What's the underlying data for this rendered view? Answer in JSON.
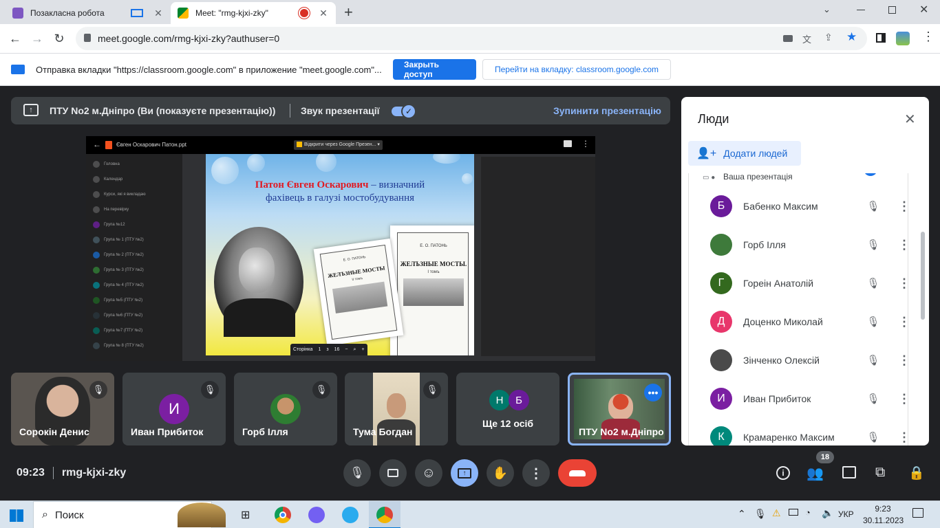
{
  "browser": {
    "tabs": [
      {
        "title": "Позакласна робота",
        "active": false
      },
      {
        "title": "Meet: \"rmg-kjxi-zky\"",
        "active": true
      }
    ],
    "new_tab": "+",
    "url": "meet.google.com/rmg-kjxi-zky?authuser=0",
    "infobar": {
      "message": "Отправка вкладки \"https://classroom.google.com\" в приложение \"meet.google.com\"...",
      "stop_button": "Закрыть доступ",
      "switch_button": "Перейти на вкладку: classroom.google.com"
    }
  },
  "presentation_bar": {
    "title": "ПТУ No2 м.Дніпро (Ви (показуєте презентацію))",
    "sound_label": "Звук презентації",
    "sound_on": true,
    "stop_label": "Зупинити презентацію"
  },
  "slide_viewer": {
    "file_name": "Євген Оскарович Патон.ppt",
    "open_with": "Відкрити через Google Презен...",
    "page_label": "Сторінка",
    "page": "1",
    "of_label": "з",
    "total": "16",
    "zoom_out": "−",
    "zoom_in": "+",
    "bg_sidebar": [
      "Головна",
      "Календар",
      "Курси, які я викладаю",
      "На перевірку",
      "Група №12",
      "Група № 1 (ПТУ №2)",
      "Група № 2 (ПТУ №2)",
      "Група № 3 (ПТУ №2)",
      "Група № 4 (ПТУ №2)",
      "Група №5 (ПТУ №2)",
      "Група №6 (ПТУ №2)",
      "Група №7 (ПТУ №2)",
      "Група № 8 (ПТУ №2)"
    ]
  },
  "slide": {
    "name_red": "Патон Євген Оскарович",
    "title_rest": " – визначний",
    "subtitle": "фахівець в галузі мостобудування",
    "book1_author": "Е. О. ПАТОНЬ",
    "book1_title": "ЖЕЛЪЗНЫЕ МОСТЫ",
    "book1_vol": "II томъ",
    "book2_author": "Е. О. ПАТОНЬ",
    "book2_title": "ЖЕЛЪЗНЫЕ МОСТЫ.",
    "book2_vol": "I томъ"
  },
  "tiles": [
    {
      "name": "Сорокін Денис",
      "type": "video"
    },
    {
      "name": "Иван Прибиток",
      "type": "avatar",
      "letter": "И",
      "color": "#7b1fa2"
    },
    {
      "name": "Горб Ілля",
      "type": "photo"
    },
    {
      "name": "Тума Богдан",
      "type": "video"
    },
    {
      "name": "Ще 12 осіб",
      "type": "more",
      "letters": [
        "Н",
        "Б"
      ],
      "colors": [
        "#00796b",
        "#6a1b9a"
      ]
    },
    {
      "name": "ПТУ No2 м.Дніпро",
      "type": "self"
    }
  ],
  "bottom": {
    "time": "09:23",
    "meeting_code": "rmg-kjxi-zky",
    "people_count": "18"
  },
  "people_panel": {
    "title": "Люди",
    "add_button": "Додати людей",
    "partial_row": "Ваша презентація",
    "people": [
      {
        "name": "Бабенко Максим",
        "letter": "Б",
        "color": "#6a1b9a"
      },
      {
        "name": "Горб Ілля",
        "letter": "",
        "color": "#3e7a3b"
      },
      {
        "name": "Гореін Анатолій",
        "letter": "Г",
        "color": "#33691e"
      },
      {
        "name": "Доценко Миколай",
        "letter": "Д",
        "color": "#e8366b"
      },
      {
        "name": "Зінченко Олексій",
        "letter": "",
        "color": "#4a4a4a"
      },
      {
        "name": "Иван Прибиток",
        "letter": "И",
        "color": "#7b1fa2"
      },
      {
        "name": "Крамаренко Максим",
        "letter": "К",
        "color": "#00897b"
      }
    ]
  },
  "taskbar": {
    "search": "Поиск",
    "lang": "УКР",
    "time": "9:23",
    "date": "30.11.2023"
  }
}
